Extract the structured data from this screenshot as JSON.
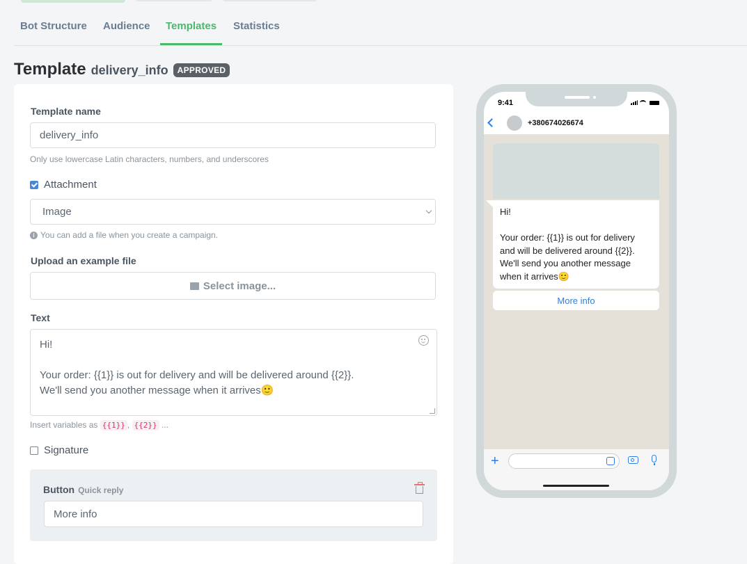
{
  "tabs": [
    "Bot Structure",
    "Audience",
    "Templates",
    "Statistics"
  ],
  "heading": {
    "title": "Template",
    "template_name": "delivery_info",
    "status_badge": "APPROVED"
  },
  "form": {
    "template_name_label": "Template name",
    "template_name_value": "delivery_info",
    "template_name_help": "Only use lowercase Latin characters, numbers, and underscores",
    "attachment_label": "Attachment",
    "attachment_checked": true,
    "attachment_type": "Image",
    "attachment_help": "You can add a file when you create a campaign.",
    "upload_label": "Upload an example file",
    "select_image_label": "Select image...",
    "text_label": "Text",
    "text_lines": [
      "Hi!",
      "",
      "Your order: {{1}} is out for delivery and will be delivered around {{2}}.",
      "We'll send you another message when it arrives🙂"
    ],
    "vars_help_prefix": "Insert variables as",
    "var1": "{{1}}",
    "var2": "{{2}}",
    "vars_help_suffix": "...",
    "signature_label": "Signature",
    "signature_checked": false,
    "button_label": "Button",
    "button_type": "Quick reply",
    "button_value": "More info"
  },
  "preview": {
    "time": "9:41",
    "phone_number": "+380674026674",
    "message_lines": [
      "Hi!",
      "",
      "Your order: {{1}} is out for delivery",
      "and will be delivered around {{2}}.",
      "We'll send you another message",
      "when it arrives🙂"
    ],
    "quick_reply": "More info"
  },
  "colors": {
    "accent_green": "#4bb86b",
    "link_blue": "#2f7de1",
    "badge_gray": "#5a6066"
  }
}
